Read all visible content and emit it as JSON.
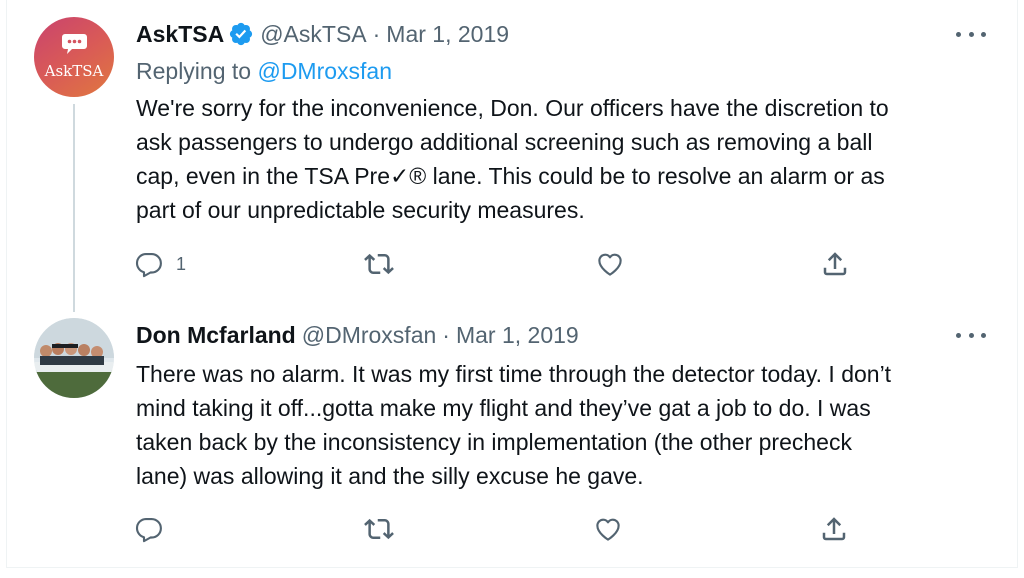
{
  "tweets": [
    {
      "name": "AskTSA",
      "verified": true,
      "handle": "@AskTSA",
      "separator": "·",
      "date": "Mar 1, 2019",
      "avatar_text": "AskTSA",
      "replying_to_label": "Replying to",
      "replying_to_handle": "@DMroxsfan",
      "text_lines": [
        "We're sorry for the inconvenience, Don. Our officers have the discretion to",
        "ask passengers to undergo additional screening such as removing a ball",
        "cap, even in the TSA Pre✓® lane. This could be to resolve an alarm or as",
        "part of our unpredictable security measures."
      ],
      "reply_count": "1",
      "retweet_count": "",
      "like_count": ""
    },
    {
      "name": "Don Mcfarland",
      "verified": false,
      "handle": "@DMroxsfan",
      "separator": "·",
      "date": "Mar 1, 2019",
      "text_lines": [
        "There was no alarm. It was my first time through the detector today. I don’t",
        "mind taking it off...gotta make my flight and they’ve gat a job to do. I was",
        "taken back by the inconsistency in implementation (the other precheck",
        "lane) was allowing it and the silly excuse he gave."
      ],
      "reply_count": "",
      "retweet_count": "",
      "like_count": ""
    }
  ],
  "icons": {
    "reply": "speech-bubble",
    "retweet": "retweet-arrows",
    "like": "heart-outline",
    "share": "share-upload",
    "more": "three-dots",
    "verified": "verified-badge"
  },
  "colors": {
    "text": "#0f1419",
    "secondary": "#536471",
    "accent": "#1d9bf0",
    "thread_line": "#cfd9de",
    "avatar_gradient_start": "#c9436e",
    "avatar_gradient_end": "#e0783f"
  }
}
